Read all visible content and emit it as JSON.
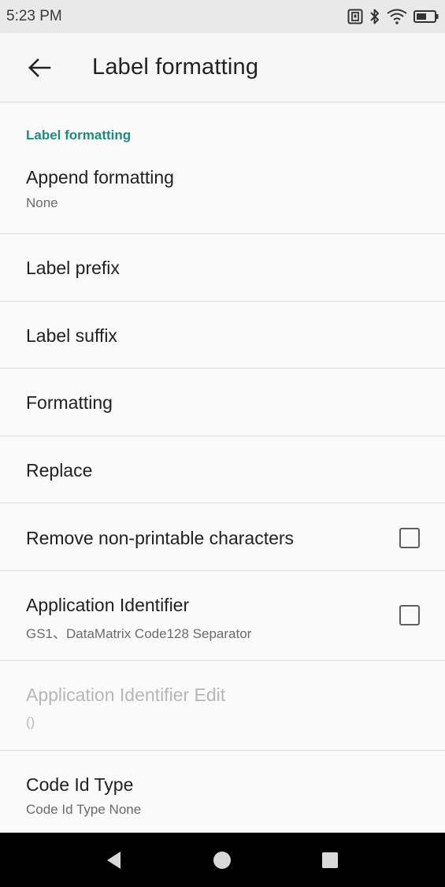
{
  "status_bar": {
    "time": "5:23 PM",
    "icons": [
      "nfc-icon",
      "bluetooth-icon",
      "wifi-icon",
      "battery-icon"
    ]
  },
  "app_bar": {
    "title": "Label formatting",
    "back_icon": "arrow-left-icon"
  },
  "colors": {
    "accent": "#1e8b7d",
    "status_bar_bg": "#e9e9e9",
    "nav_bar_bg": "#000000"
  },
  "section": {
    "header": "Label formatting"
  },
  "preferences": [
    {
      "title": "Append formatting",
      "summary": "None"
    },
    {
      "title": "Label prefix"
    },
    {
      "title": "Label suffix"
    },
    {
      "title": "Formatting"
    },
    {
      "title": "Replace"
    },
    {
      "title": "Remove non-printable characters",
      "checked": false
    },
    {
      "title": "Application Identifier",
      "summary": "GS1、DataMatrix Code128 Separator",
      "checked": false
    },
    {
      "title": "Application Identifier Edit",
      "summary": "()",
      "enabled": false
    },
    {
      "title": "Code Id Type",
      "summary": "Code Id Type None"
    }
  ],
  "nav_bar": {
    "buttons": [
      "back-triangle-icon",
      "home-circle-icon",
      "recents-square-icon"
    ]
  }
}
